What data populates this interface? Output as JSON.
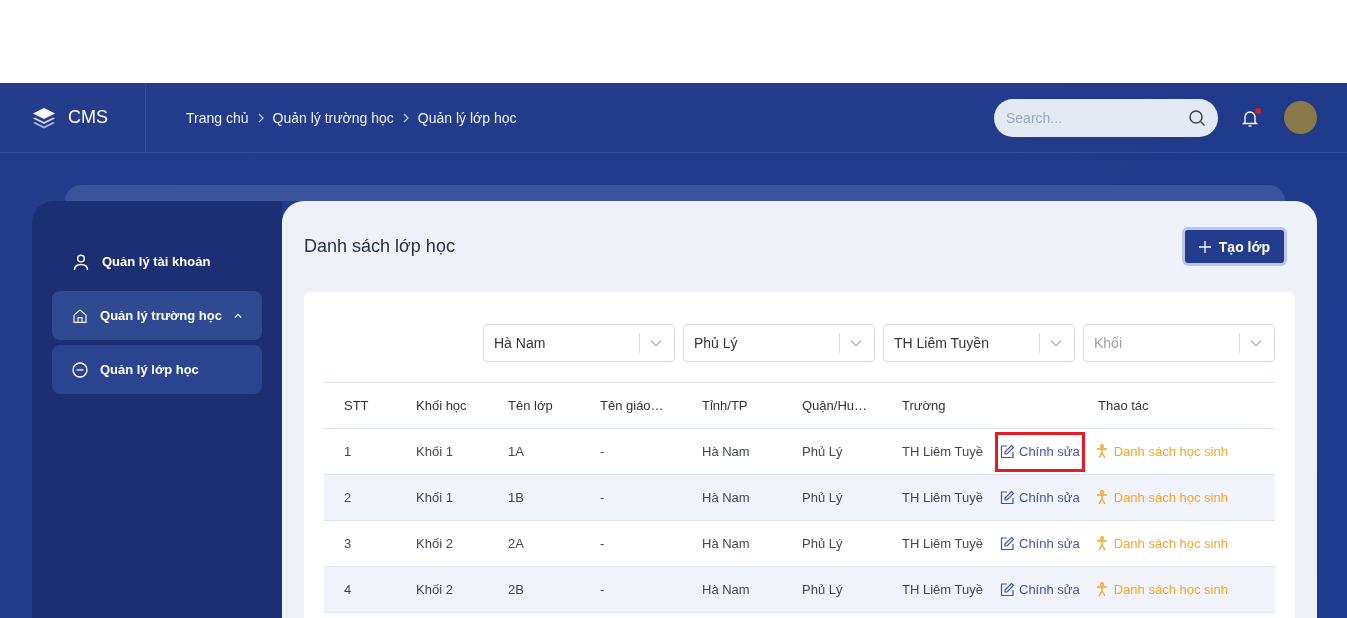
{
  "header": {
    "logo": "CMS",
    "breadcrumb": [
      "Trang chủ",
      "Quản lý trường học",
      "Quản lý lớp học"
    ],
    "search": {
      "placeholder": "Search..."
    },
    "notification_dot": true
  },
  "sidebar": {
    "items": [
      {
        "label": "Quản lý tài khoản",
        "selected": false
      },
      {
        "label": "Quản lý trường học",
        "selected": true,
        "expanded": true,
        "children": [
          {
            "label": "Quản lý lớp học",
            "selected": true
          }
        ]
      }
    ]
  },
  "main": {
    "title": "Danh sách lớp học",
    "create_button": "Tạo lớp",
    "filters": [
      {
        "value": "Hà Nam"
      },
      {
        "value": "Phủ Lý"
      },
      {
        "value": "TH Liêm Tuyền"
      },
      {
        "placeholder": "Khối"
      }
    ],
    "table": {
      "columns": [
        "STT",
        "Khối học",
        "Tên lớp",
        "Tên giáo…",
        "Tỉnh/TP",
        "Quận/Hu…",
        "Trường",
        "Thao tác"
      ],
      "rows": [
        {
          "cells": [
            "1",
            "Khối 1",
            "1A",
            "-",
            "Hà Nam",
            "Phủ Lý",
            "TH Liêm Tuyề"
          ],
          "edit": "Chính sửa",
          "students": "Danh sách học sinh",
          "highlighted": true
        },
        {
          "cells": [
            "2",
            "Khối 1",
            "1B",
            "-",
            "Hà Nam",
            "Phủ Lý",
            "TH Liêm Tuyề"
          ],
          "edit": "Chính sửa",
          "students": "Danh sách học sinh",
          "highlighted": false
        },
        {
          "cells": [
            "3",
            "Khối 2",
            "2A",
            "-",
            "Hà Nam",
            "Phủ Lý",
            "TH Liêm Tuyề"
          ],
          "edit": "Chính sửa",
          "students": "Danh sách học sinh",
          "highlighted": false
        },
        {
          "cells": [
            "4",
            "Khối 2",
            "2B",
            "-",
            "Hà Nam",
            "Phủ Lý",
            "TH Liêm Tuyề"
          ],
          "edit": "Chính sửa",
          "students": "Danh sách học sinh",
          "highlighted": false
        }
      ]
    }
  }
}
